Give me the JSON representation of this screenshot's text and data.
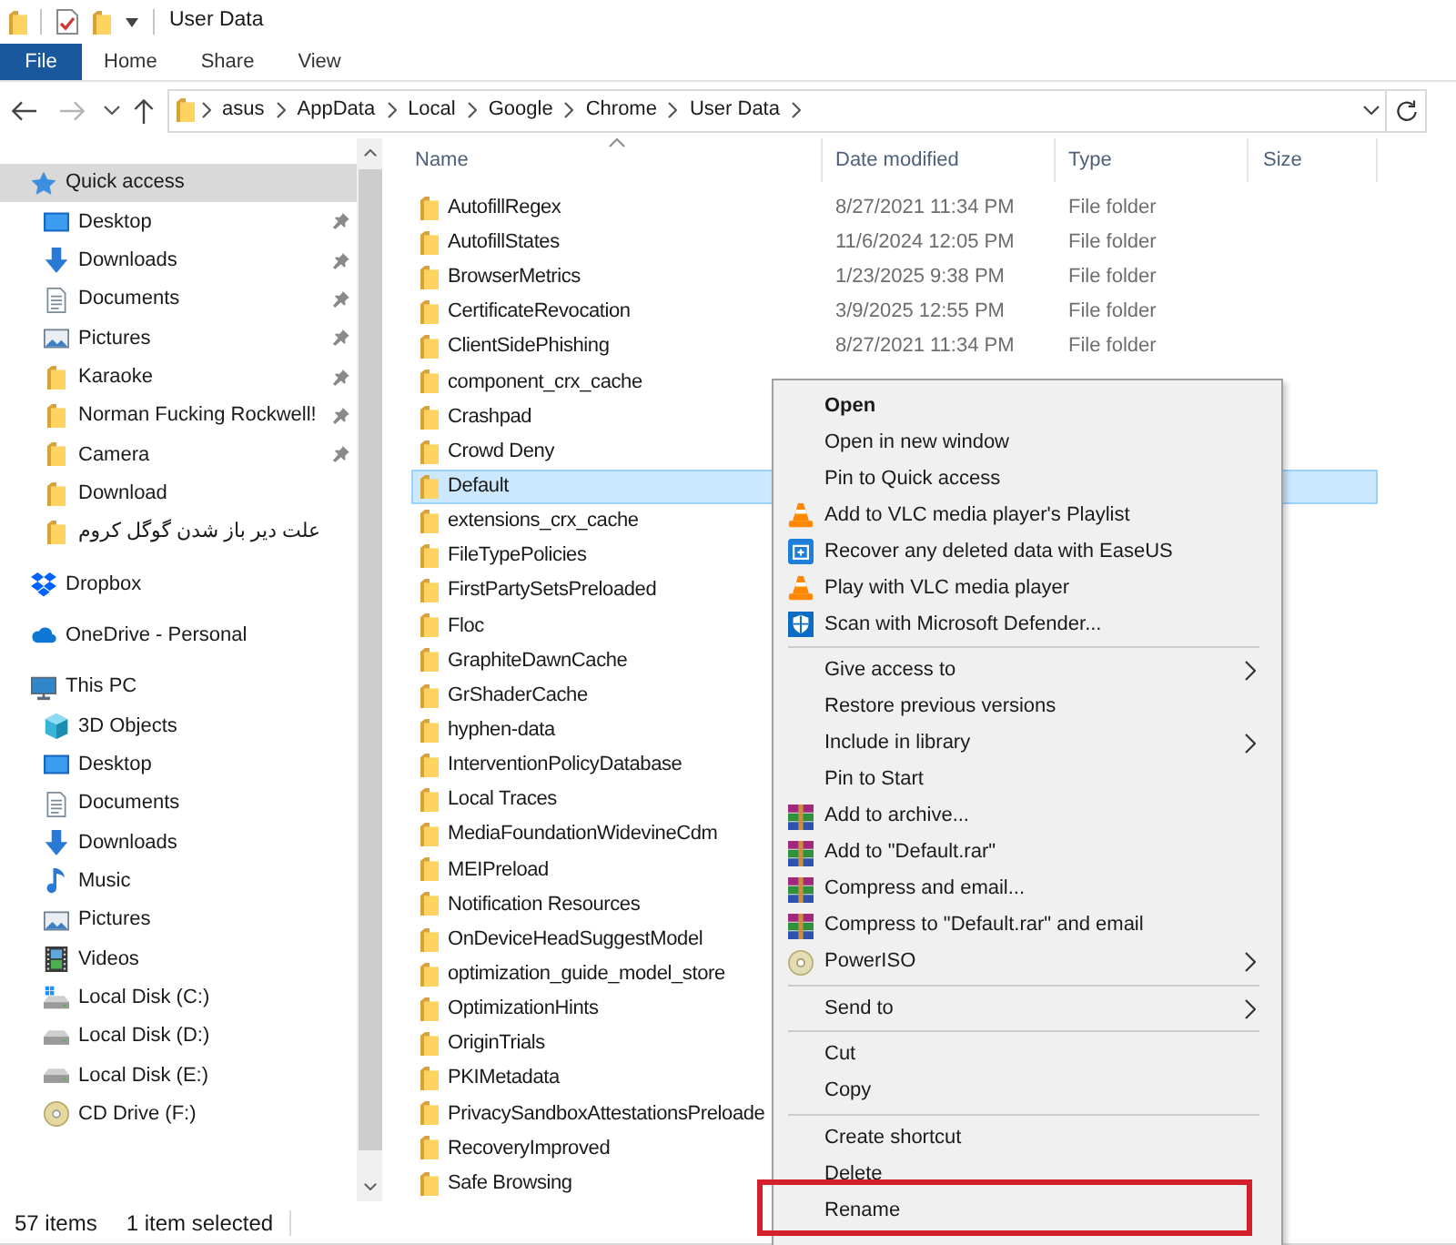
{
  "title_bar": {
    "title": "User Data"
  },
  "ribbon": {
    "tabs": [
      {
        "label": "File",
        "kind": "file"
      },
      {
        "label": "Home",
        "kind": "tab"
      },
      {
        "label": "Share",
        "kind": "tab"
      },
      {
        "label": "View",
        "kind": "tab"
      }
    ]
  },
  "address_bar": {
    "back_disabled": false,
    "forward_disabled": true,
    "path": [
      "asus",
      "AppData",
      "Local",
      "Google",
      "Chrome",
      "User Data"
    ]
  },
  "navigation_pane": {
    "items": [
      {
        "label": "Quick access",
        "kind": "quickaccess",
        "selected": true,
        "children": [
          {
            "label": "Desktop",
            "kind": "desktop",
            "pinned": true,
            "selected": false
          },
          {
            "label": "Downloads",
            "kind": "downloads",
            "pinned": true,
            "selected": false
          },
          {
            "label": "Documents",
            "kind": "documents",
            "pinned": true,
            "selected": false
          },
          {
            "label": "Pictures",
            "kind": "pictures",
            "pinned": true,
            "selected": false
          },
          {
            "label": "Karaoke",
            "kind": "folder",
            "pinned": true,
            "selected": false
          },
          {
            "label": "Norman Fucking Rockwell!",
            "kind": "folder",
            "pinned": true,
            "selected": false
          },
          {
            "label": "Camera",
            "kind": "folder",
            "pinned": true,
            "selected": false
          },
          {
            "label": "Download",
            "kind": "folder",
            "pinned": false,
            "selected": false
          },
          {
            "label": "علت دیر باز شدن گوگل کروم",
            "kind": "folder",
            "pinned": false,
            "selected": false
          }
        ]
      },
      {
        "label": "Dropbox",
        "kind": "dropbox",
        "selected": false
      },
      {
        "label": "OneDrive - Personal",
        "kind": "onedrive",
        "selected": false
      },
      {
        "label": "This PC",
        "kind": "computer",
        "selected": false,
        "children": [
          {
            "label": "3D Objects",
            "kind": "objects",
            "selected": false
          },
          {
            "label": "Desktop",
            "kind": "desktop",
            "selected": false
          },
          {
            "label": "Documents",
            "kind": "documents",
            "selected": false
          },
          {
            "label": "Downloads",
            "kind": "downloads",
            "selected": false
          },
          {
            "label": "Music",
            "kind": "music",
            "selected": false
          },
          {
            "label": "Pictures",
            "kind": "pictures",
            "selected": false
          },
          {
            "label": "Videos",
            "kind": "videos",
            "selected": false
          },
          {
            "label": "Local Disk (C:)",
            "kind": "systemdrive",
            "selected": false
          },
          {
            "label": "Local Disk (D:)",
            "kind": "drive",
            "selected": false
          },
          {
            "label": "Local Disk (E:)",
            "kind": "drive",
            "selected": false
          },
          {
            "label": "CD Drive (F:)",
            "kind": "optical",
            "selected": false
          }
        ]
      }
    ]
  },
  "file_list": {
    "columns": [
      {
        "label": "Name",
        "sorted": true
      },
      {
        "label": "Date modified",
        "sorted": false
      },
      {
        "label": "Type",
        "sorted": false
      },
      {
        "label": "Size",
        "sorted": false
      }
    ],
    "rows": [
      {
        "name": "AutofillRegex",
        "date": "8/27/2021 11:34 PM",
        "type": "File folder",
        "selected": false
      },
      {
        "name": "AutofillStates",
        "date": "11/6/2024 12:05 PM",
        "type": "File folder",
        "selected": false
      },
      {
        "name": "BrowserMetrics",
        "date": "1/23/2025 9:38 PM",
        "type": "File folder",
        "selected": false
      },
      {
        "name": "CertificateRevocation",
        "date": "3/9/2025 12:55 PM",
        "type": "File folder",
        "selected": false
      },
      {
        "name": "ClientSidePhishing",
        "date": "8/27/2021 11:34 PM",
        "type": "File folder",
        "selected": false
      },
      {
        "name": "component_crx_cache",
        "selected": false
      },
      {
        "name": "Crashpad",
        "selected": false
      },
      {
        "name": "Crowd Deny",
        "selected": false
      },
      {
        "name": "Default",
        "selected": true
      },
      {
        "name": "extensions_crx_cache",
        "selected": false
      },
      {
        "name": "FileTypePolicies",
        "selected": false
      },
      {
        "name": "FirstPartySetsPreloaded",
        "selected": false
      },
      {
        "name": "Floc",
        "selected": false
      },
      {
        "name": "GraphiteDawnCache",
        "selected": false
      },
      {
        "name": "GrShaderCache",
        "selected": false
      },
      {
        "name": "hyphen-data",
        "selected": false
      },
      {
        "name": "InterventionPolicyDatabase",
        "selected": false
      },
      {
        "name": "Local Traces",
        "selected": false
      },
      {
        "name": "MediaFoundationWidevineCdm",
        "selected": false
      },
      {
        "name": "MEIPreload",
        "selected": false
      },
      {
        "name": "Notification Resources",
        "selected": false
      },
      {
        "name": "OnDeviceHeadSuggestModel",
        "selected": false
      },
      {
        "name": "optimization_guide_model_store",
        "selected": false
      },
      {
        "name": "OptimizationHints",
        "selected": false
      },
      {
        "name": "OriginTrials",
        "selected": false
      },
      {
        "name": "PKIMetadata",
        "selected": false
      },
      {
        "name": "PrivacySandboxAttestationsPreloade",
        "selected": false
      },
      {
        "name": "RecoveryImproved",
        "selected": false
      },
      {
        "name": "Safe Browsing",
        "selected": false
      }
    ]
  },
  "context_menu": {
    "items": [
      {
        "label": "Open",
        "kind": "command",
        "default": true,
        "submenu": false,
        "outlined": false
      },
      {
        "label": "Open in new window",
        "kind": "command",
        "default": false,
        "submenu": false,
        "outlined": false
      },
      {
        "label": "Pin to Quick access",
        "kind": "command",
        "default": false,
        "submenu": false,
        "outlined": false
      },
      {
        "label": "Add to VLC media player's Playlist",
        "kind": "vlc",
        "default": false,
        "submenu": false,
        "outlined": false
      },
      {
        "label": "Recover any deleted data with EaseUS",
        "kind": "easeus",
        "default": false,
        "submenu": false,
        "outlined": false
      },
      {
        "label": "Play with VLC media player",
        "kind": "vlc",
        "default": false,
        "submenu": false,
        "outlined": false
      },
      {
        "label": "Scan with Microsoft Defender...",
        "kind": "defender",
        "default": false,
        "submenu": false,
        "outlined": false
      },
      {
        "kind": "separator"
      },
      {
        "label": "Give access to",
        "kind": "command",
        "default": false,
        "submenu": true,
        "outlined": false
      },
      {
        "label": "Restore previous versions",
        "kind": "command",
        "default": false,
        "submenu": false,
        "outlined": false
      },
      {
        "label": "Include in library",
        "kind": "command",
        "default": false,
        "submenu": true,
        "outlined": false
      },
      {
        "label": "Pin to Start",
        "kind": "command",
        "default": false,
        "submenu": false,
        "outlined": false
      },
      {
        "label": "Add to archive...",
        "kind": "winrar",
        "default": false,
        "submenu": false,
        "outlined": false
      },
      {
        "label": "Add to \"Default.rar\"",
        "kind": "winrar",
        "default": false,
        "submenu": false,
        "outlined": false
      },
      {
        "label": "Compress and email...",
        "kind": "winrar",
        "default": false,
        "submenu": false,
        "outlined": false
      },
      {
        "label": "Compress to \"Default.rar\" and email",
        "kind": "winrar",
        "default": false,
        "submenu": false,
        "outlined": false
      },
      {
        "label": "PowerISO",
        "kind": "poweriso",
        "default": false,
        "submenu": true,
        "outlined": false
      },
      {
        "kind": "separator"
      },
      {
        "label": "Send to",
        "kind": "command",
        "default": false,
        "submenu": true,
        "outlined": false
      },
      {
        "kind": "separator"
      },
      {
        "label": "Cut",
        "kind": "command",
        "default": false,
        "submenu": false,
        "outlined": false
      },
      {
        "label": "Copy",
        "kind": "command",
        "default": false,
        "submenu": false,
        "outlined": false
      },
      {
        "kind": "separator"
      },
      {
        "label": "Create shortcut",
        "kind": "command",
        "default": false,
        "submenu": false,
        "outlined": false
      },
      {
        "label": "Delete",
        "kind": "command",
        "default": false,
        "submenu": false,
        "outlined": false
      },
      {
        "label": "Rename",
        "kind": "command",
        "default": false,
        "submenu": false,
        "outlined": true
      }
    ]
  },
  "status_bar": {
    "item_count": "57 items",
    "selection": "1 item selected"
  }
}
